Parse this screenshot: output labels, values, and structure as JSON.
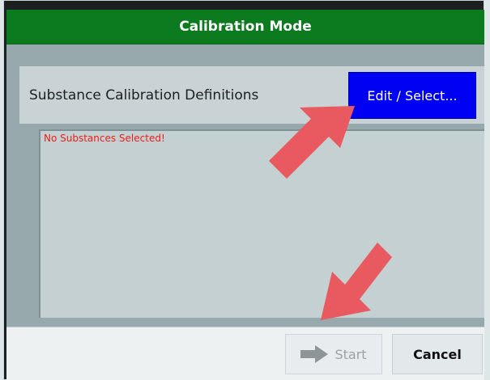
{
  "window": {
    "title": "Calibration Mode"
  },
  "definitions": {
    "label": "Substance Calibration Definitions",
    "edit_button": "Edit / Select..."
  },
  "substance_list": {
    "empty_message": "No Substances Selected!"
  },
  "footer": {
    "start_label": "Start",
    "start_icon": "arrow-right-icon",
    "start_enabled": false,
    "cancel_label": "Cancel"
  },
  "colors": {
    "titlebar": "#0c7a1f",
    "edit_button": "#0000f2",
    "empty_message": "#e8201a",
    "annotation_arrow": "#e85a5f"
  }
}
